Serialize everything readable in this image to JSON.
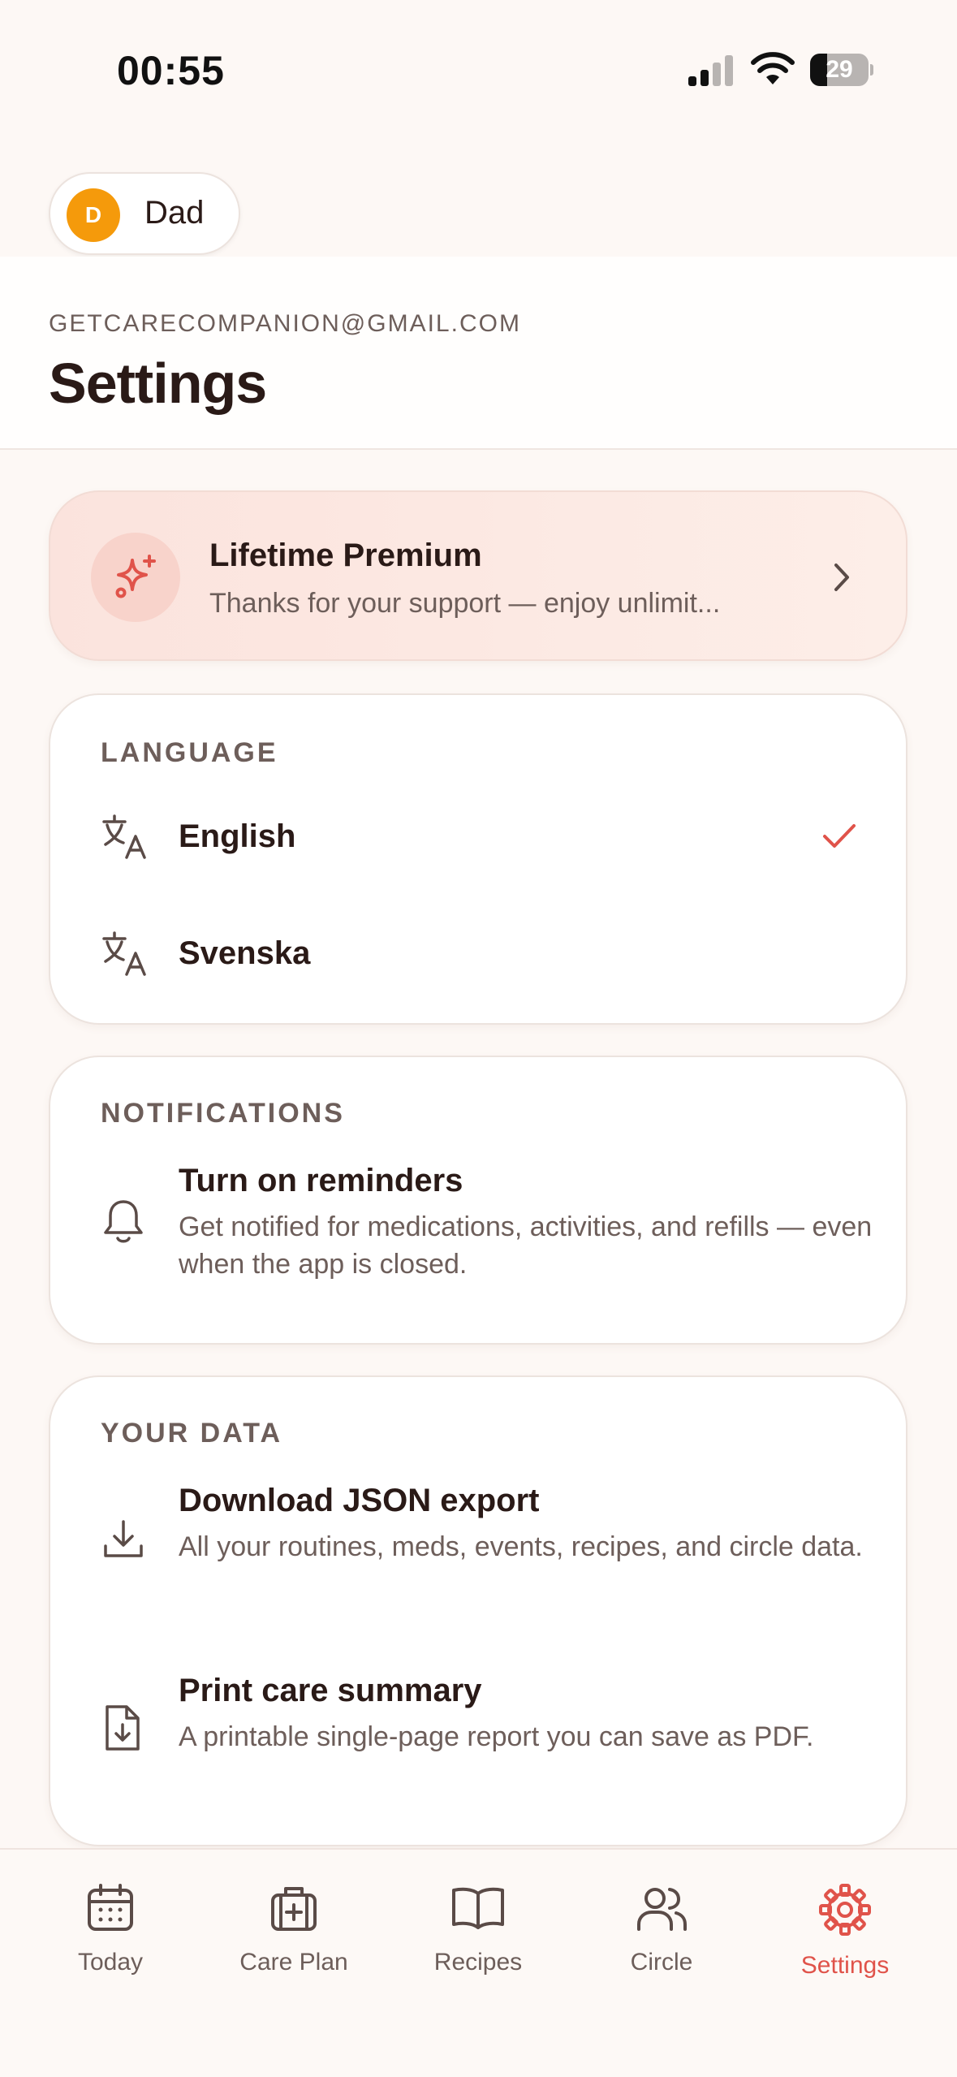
{
  "status_bar": {
    "time": "00:55",
    "battery_level": "29",
    "battery_fraction": 0.29
  },
  "profile": {
    "initial": "D",
    "name": "Dad",
    "avatar_color": "#f59a0b"
  },
  "header": {
    "email": "GETCARECOMPANION@GMAIL.COM",
    "title": "Settings"
  },
  "premium": {
    "title": "Lifetime Premium",
    "subtitle": "Thanks for your support — enjoy unlimit...",
    "icon": "sparkles-icon",
    "accent_color": "#e0534a"
  },
  "language": {
    "section_label": "LANGUAGE",
    "options": [
      {
        "label": "English",
        "selected": true
      },
      {
        "label": "Svenska",
        "selected": false
      }
    ]
  },
  "notifications": {
    "section_label": "NOTIFICATIONS",
    "reminders": {
      "title": "Turn on reminders",
      "description": "Get notified for medications, activities, and refills — even when the app is closed."
    }
  },
  "your_data": {
    "section_label": "YOUR DATA",
    "items": [
      {
        "title": "Download JSON export",
        "description": "All your routines, meds, events, recipes, and circle data.",
        "icon": "download-icon"
      },
      {
        "title": "Print care summary",
        "description": "A printable single-page report you can save as PDF.",
        "icon": "file-download-icon"
      }
    ]
  },
  "nav": {
    "items": [
      {
        "label": "Today",
        "icon": "calendar-icon",
        "active": false
      },
      {
        "label": "Care Plan",
        "icon": "medical-bag-icon",
        "active": false
      },
      {
        "label": "Recipes",
        "icon": "book-open-icon",
        "active": false
      },
      {
        "label": "Circle",
        "icon": "users-icon",
        "active": false
      },
      {
        "label": "Settings",
        "icon": "gear-icon",
        "active": true
      }
    ],
    "active_color": "#e0534a",
    "inactive_color": "#6d5e5a"
  }
}
